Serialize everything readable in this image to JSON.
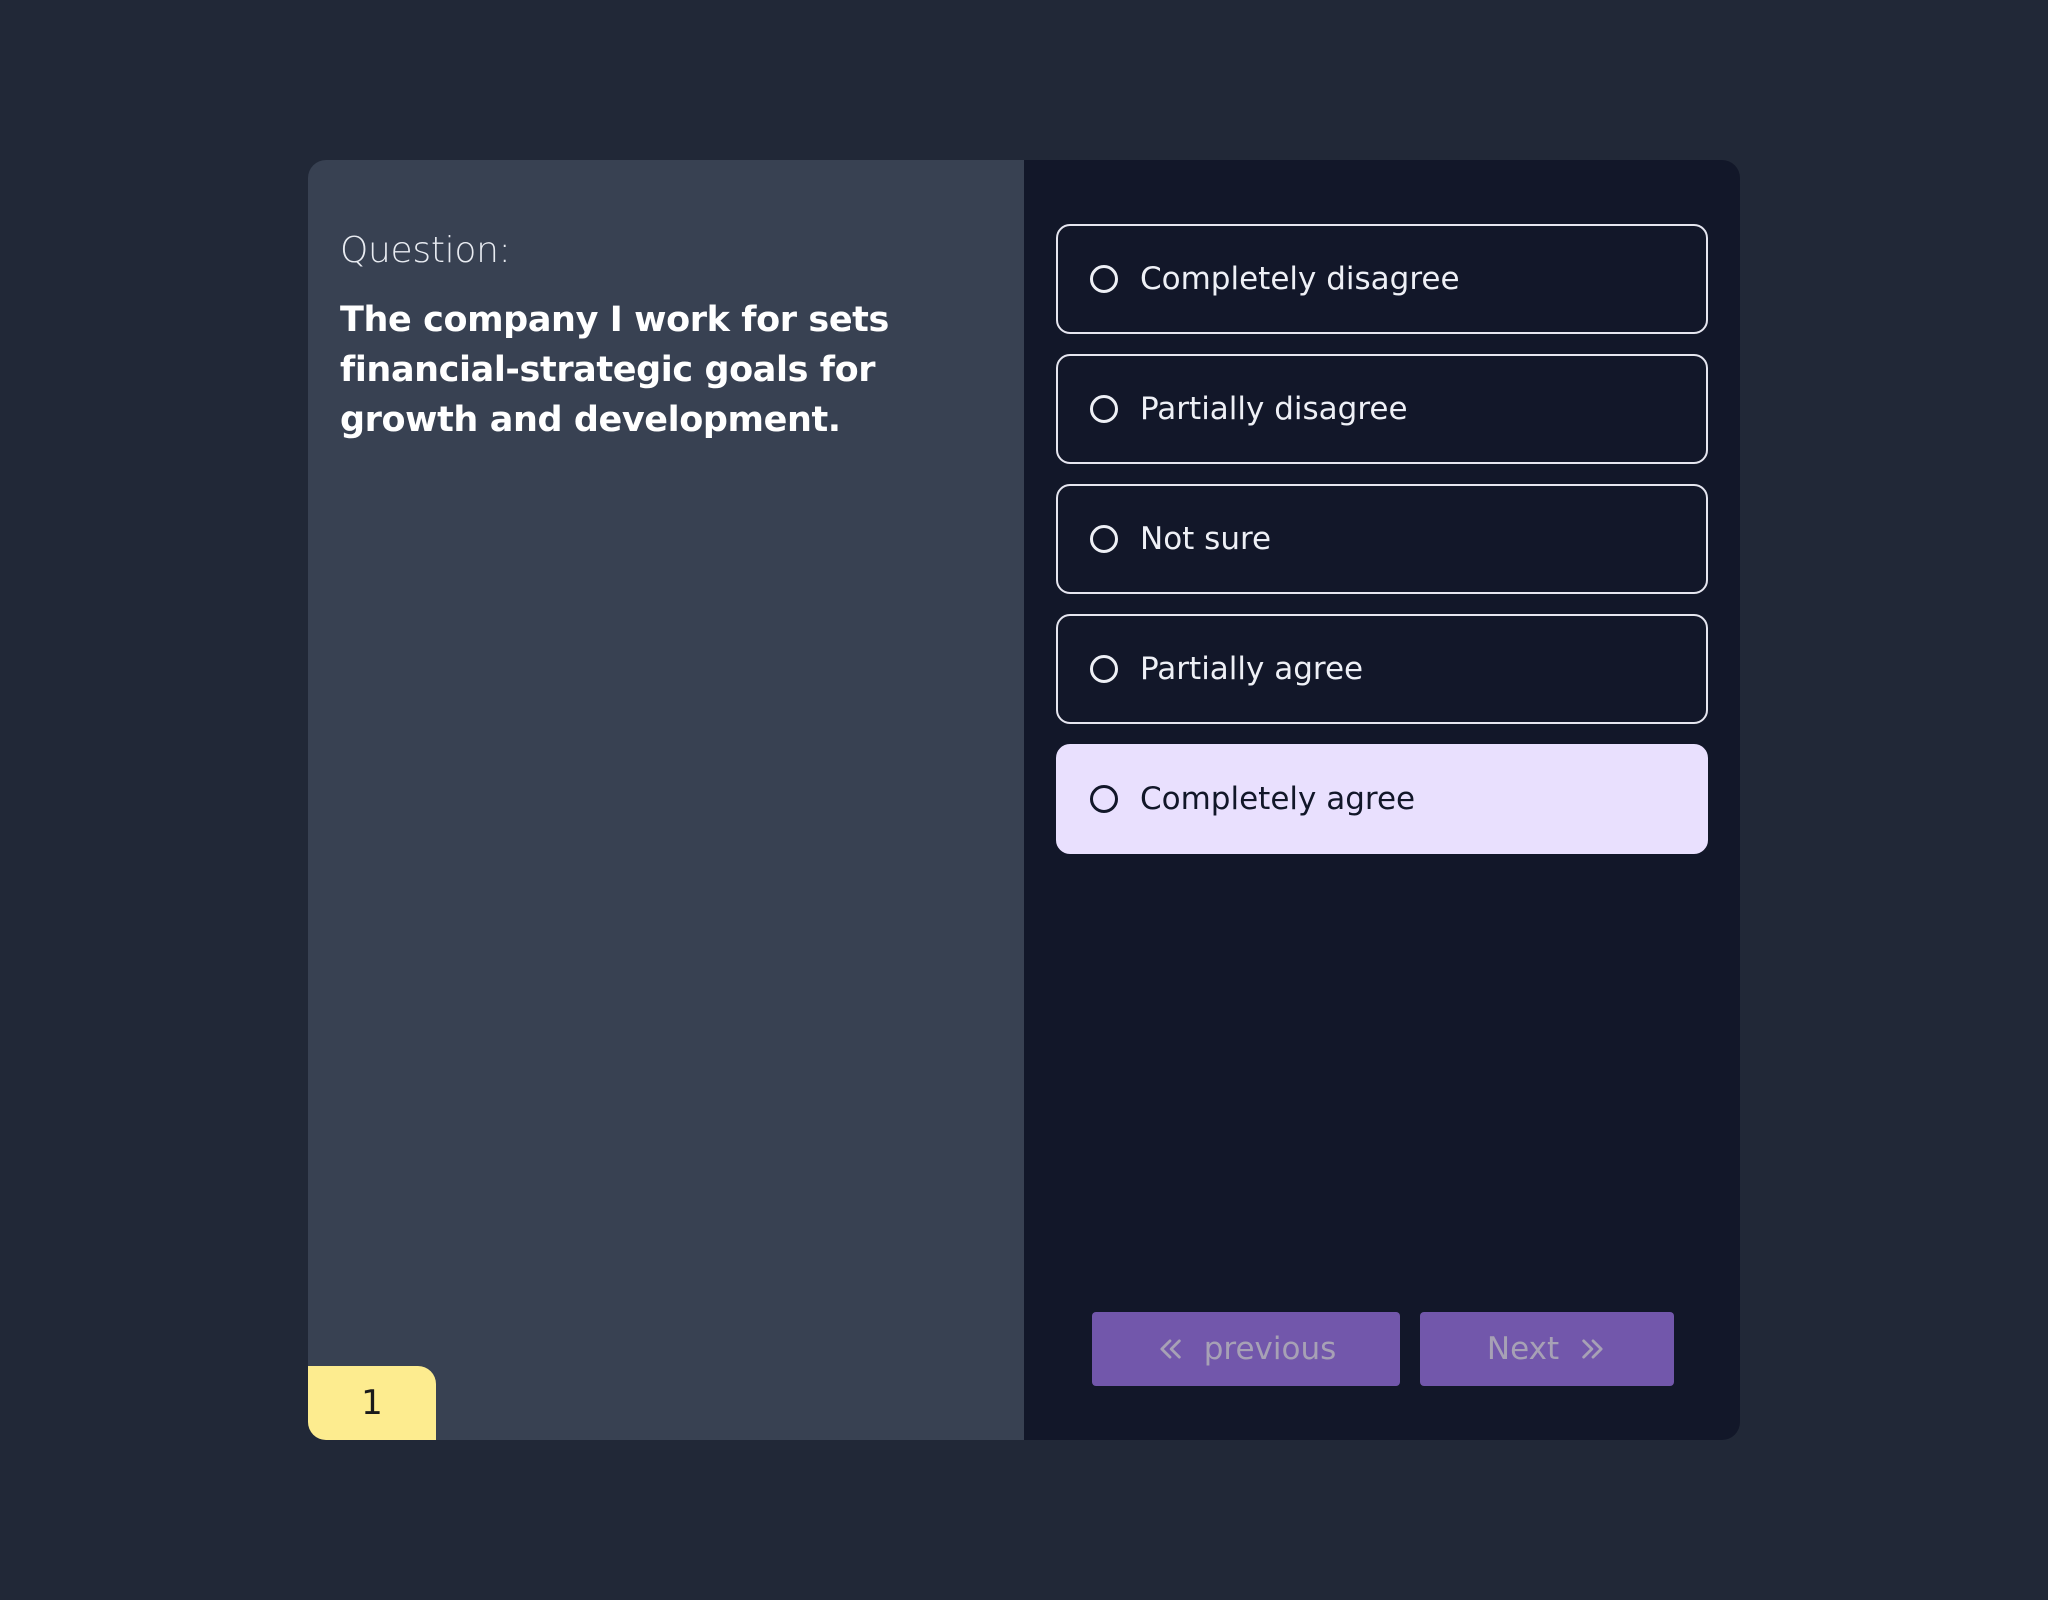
{
  "question": {
    "label": "Question:",
    "text": "The company I work for sets financial-strategic goals for growth and development.",
    "number": "1"
  },
  "options": [
    {
      "label": "Completely disagree",
      "selected": false
    },
    {
      "label": "Partially disagree",
      "selected": false
    },
    {
      "label": "Not sure",
      "selected": false
    },
    {
      "label": "Partially agree",
      "selected": false
    },
    {
      "label": "Completely agree",
      "selected": true
    }
  ],
  "navigation": {
    "previous_label": "previous",
    "next_label": "Next",
    "previous_icon": "double-chevron-left-icon",
    "next_icon": "double-chevron-right-icon"
  },
  "colors": {
    "page_background": "#212837",
    "question_panel": "#384152",
    "answer_panel": "#121729",
    "selected_option": "#e9e0fe",
    "nav_button": "#7257ab",
    "question_number_badge": "#fdec8f"
  }
}
